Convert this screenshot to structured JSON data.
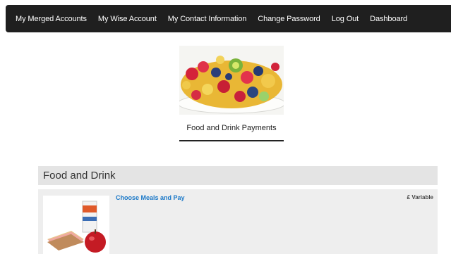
{
  "nav": {
    "items": [
      {
        "label": "My Merged Accounts"
      },
      {
        "label": "My Wise Account"
      },
      {
        "label": "My Contact Information"
      },
      {
        "label": "Change Password"
      },
      {
        "label": "Log Out"
      },
      {
        "label": "Dashboard"
      }
    ]
  },
  "hero": {
    "caption": "Food and Drink Payments",
    "image_icon": "fruit-salad-bowl-image"
  },
  "section": {
    "title": "Food and Drink"
  },
  "product": {
    "title": "Choose Meals and Pay",
    "price": "£ Variable",
    "image_icon": "meal-sandwich-apple-drink-image"
  },
  "colors": {
    "navbar_bg": "#1f1f1f",
    "link_blue": "#1a78c8",
    "section_header_bg": "#e4e4e4",
    "product_row_bg": "#eeeeee"
  }
}
